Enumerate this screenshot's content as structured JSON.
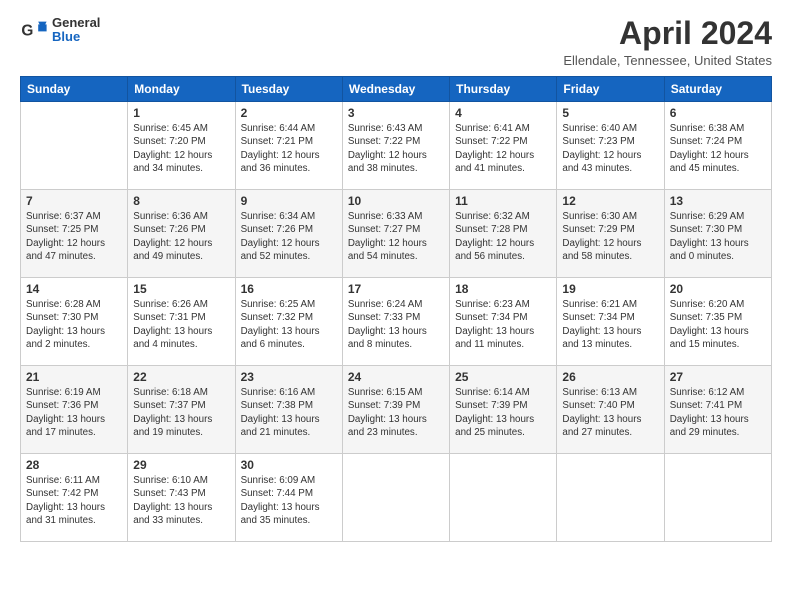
{
  "header": {
    "logo": {
      "general": "General",
      "blue": "Blue"
    },
    "title": "April 2024",
    "location": "Ellendale, Tennessee, United States"
  },
  "weekdays": [
    "Sunday",
    "Monday",
    "Tuesday",
    "Wednesday",
    "Thursday",
    "Friday",
    "Saturday"
  ],
  "weeks": [
    [
      {
        "day": "",
        "info": ""
      },
      {
        "day": "1",
        "info": "Sunrise: 6:45 AM\nSunset: 7:20 PM\nDaylight: 12 hours\nand 34 minutes."
      },
      {
        "day": "2",
        "info": "Sunrise: 6:44 AM\nSunset: 7:21 PM\nDaylight: 12 hours\nand 36 minutes."
      },
      {
        "day": "3",
        "info": "Sunrise: 6:43 AM\nSunset: 7:22 PM\nDaylight: 12 hours\nand 38 minutes."
      },
      {
        "day": "4",
        "info": "Sunrise: 6:41 AM\nSunset: 7:22 PM\nDaylight: 12 hours\nand 41 minutes."
      },
      {
        "day": "5",
        "info": "Sunrise: 6:40 AM\nSunset: 7:23 PM\nDaylight: 12 hours\nand 43 minutes."
      },
      {
        "day": "6",
        "info": "Sunrise: 6:38 AM\nSunset: 7:24 PM\nDaylight: 12 hours\nand 45 minutes."
      }
    ],
    [
      {
        "day": "7",
        "info": "Sunrise: 6:37 AM\nSunset: 7:25 PM\nDaylight: 12 hours\nand 47 minutes."
      },
      {
        "day": "8",
        "info": "Sunrise: 6:36 AM\nSunset: 7:26 PM\nDaylight: 12 hours\nand 49 minutes."
      },
      {
        "day": "9",
        "info": "Sunrise: 6:34 AM\nSunset: 7:26 PM\nDaylight: 12 hours\nand 52 minutes."
      },
      {
        "day": "10",
        "info": "Sunrise: 6:33 AM\nSunset: 7:27 PM\nDaylight: 12 hours\nand 54 minutes."
      },
      {
        "day": "11",
        "info": "Sunrise: 6:32 AM\nSunset: 7:28 PM\nDaylight: 12 hours\nand 56 minutes."
      },
      {
        "day": "12",
        "info": "Sunrise: 6:30 AM\nSunset: 7:29 PM\nDaylight: 12 hours\nand 58 minutes."
      },
      {
        "day": "13",
        "info": "Sunrise: 6:29 AM\nSunset: 7:30 PM\nDaylight: 13 hours\nand 0 minutes."
      }
    ],
    [
      {
        "day": "14",
        "info": "Sunrise: 6:28 AM\nSunset: 7:30 PM\nDaylight: 13 hours\nand 2 minutes."
      },
      {
        "day": "15",
        "info": "Sunrise: 6:26 AM\nSunset: 7:31 PM\nDaylight: 13 hours\nand 4 minutes."
      },
      {
        "day": "16",
        "info": "Sunrise: 6:25 AM\nSunset: 7:32 PM\nDaylight: 13 hours\nand 6 minutes."
      },
      {
        "day": "17",
        "info": "Sunrise: 6:24 AM\nSunset: 7:33 PM\nDaylight: 13 hours\nand 8 minutes."
      },
      {
        "day": "18",
        "info": "Sunrise: 6:23 AM\nSunset: 7:34 PM\nDaylight: 13 hours\nand 11 minutes."
      },
      {
        "day": "19",
        "info": "Sunrise: 6:21 AM\nSunset: 7:34 PM\nDaylight: 13 hours\nand 13 minutes."
      },
      {
        "day": "20",
        "info": "Sunrise: 6:20 AM\nSunset: 7:35 PM\nDaylight: 13 hours\nand 15 minutes."
      }
    ],
    [
      {
        "day": "21",
        "info": "Sunrise: 6:19 AM\nSunset: 7:36 PM\nDaylight: 13 hours\nand 17 minutes."
      },
      {
        "day": "22",
        "info": "Sunrise: 6:18 AM\nSunset: 7:37 PM\nDaylight: 13 hours\nand 19 minutes."
      },
      {
        "day": "23",
        "info": "Sunrise: 6:16 AM\nSunset: 7:38 PM\nDaylight: 13 hours\nand 21 minutes."
      },
      {
        "day": "24",
        "info": "Sunrise: 6:15 AM\nSunset: 7:39 PM\nDaylight: 13 hours\nand 23 minutes."
      },
      {
        "day": "25",
        "info": "Sunrise: 6:14 AM\nSunset: 7:39 PM\nDaylight: 13 hours\nand 25 minutes."
      },
      {
        "day": "26",
        "info": "Sunrise: 6:13 AM\nSunset: 7:40 PM\nDaylight: 13 hours\nand 27 minutes."
      },
      {
        "day": "27",
        "info": "Sunrise: 6:12 AM\nSunset: 7:41 PM\nDaylight: 13 hours\nand 29 minutes."
      }
    ],
    [
      {
        "day": "28",
        "info": "Sunrise: 6:11 AM\nSunset: 7:42 PM\nDaylight: 13 hours\nand 31 minutes."
      },
      {
        "day": "29",
        "info": "Sunrise: 6:10 AM\nSunset: 7:43 PM\nDaylight: 13 hours\nand 33 minutes."
      },
      {
        "day": "30",
        "info": "Sunrise: 6:09 AM\nSunset: 7:44 PM\nDaylight: 13 hours\nand 35 minutes."
      },
      {
        "day": "",
        "info": ""
      },
      {
        "day": "",
        "info": ""
      },
      {
        "day": "",
        "info": ""
      },
      {
        "day": "",
        "info": ""
      }
    ]
  ]
}
